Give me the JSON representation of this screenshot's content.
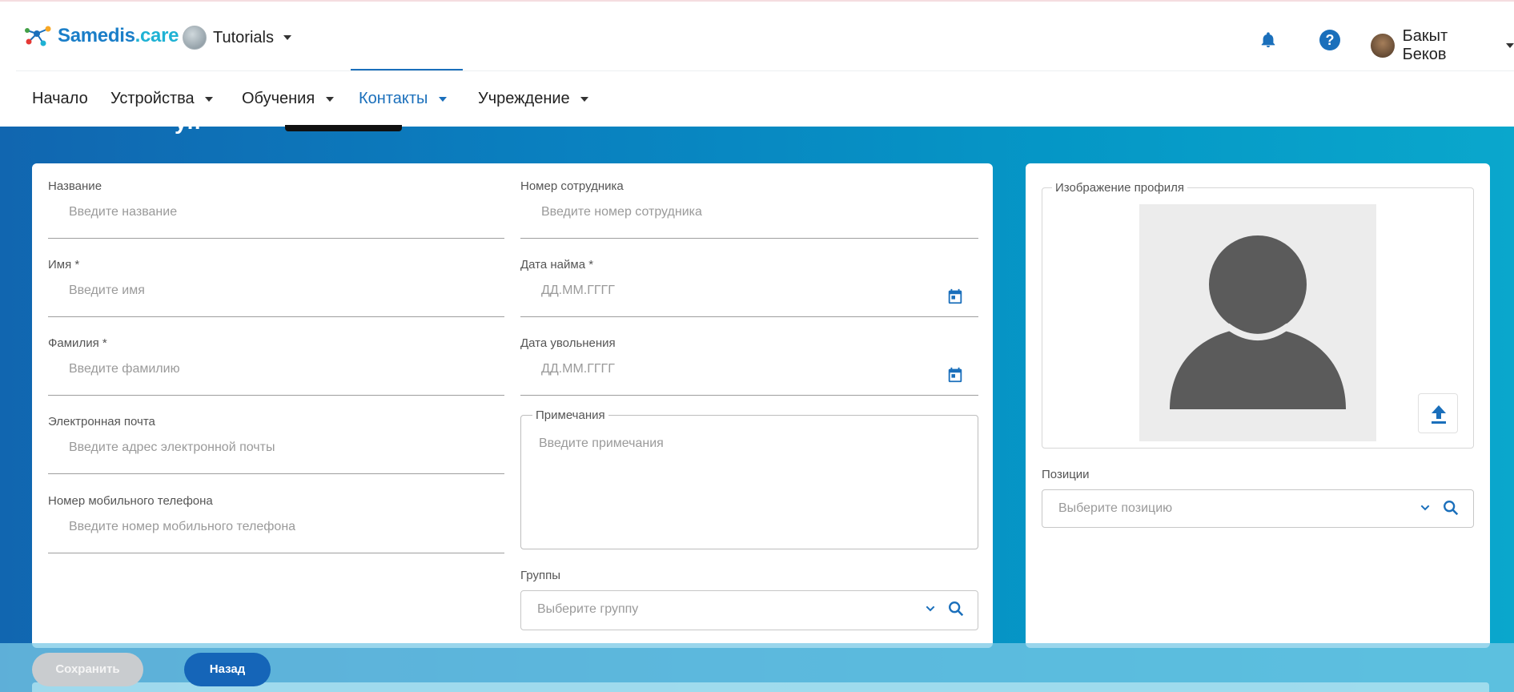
{
  "header": {
    "logo_text_main": "Samedis",
    "logo_text_tld": ".care",
    "tenant_name": "Tutorials",
    "user_name": "Бакыт Беков"
  },
  "nav": {
    "items": [
      {
        "label": "Начало"
      },
      {
        "label": "Устройства"
      },
      {
        "label": "Обучения"
      },
      {
        "label": "Контакты"
      },
      {
        "label": "Учреждение"
      }
    ]
  },
  "page": {
    "partial_title": "уп"
  },
  "form": {
    "name": {
      "label": "Название",
      "placeholder": "Введите название"
    },
    "first_name": {
      "label": "Имя *",
      "placeholder": "Введите имя"
    },
    "last_name": {
      "label": "Фамилия *",
      "placeholder": "Введите фамилию"
    },
    "email": {
      "label": "Электронная почта",
      "placeholder": "Введите адрес электронной почты"
    },
    "mobile": {
      "label": "Номер мобильного телефона",
      "placeholder": "Введите номер мобильного телефона"
    },
    "employee_number": {
      "label": "Номер сотрудника",
      "placeholder": "Введите номер сотрудника"
    },
    "hire_date": {
      "label": "Дата найма *",
      "placeholder": "ДД.ММ.ГГГГ"
    },
    "termination_date": {
      "label": "Дата увольнения",
      "placeholder": "ДД.ММ.ГГГГ"
    },
    "notes": {
      "label": "Примечания",
      "placeholder": "Введите примечания"
    },
    "groups": {
      "label": "Группы",
      "placeholder": "Выберите группу"
    },
    "profile_image": {
      "label": "Изображение профиля"
    },
    "positions": {
      "label": "Позиции",
      "placeholder": "Выберите позицию"
    }
  },
  "actions": {
    "save_label": "Сохранить",
    "back_label": "Назад"
  },
  "colors": {
    "brand_blue": "#1a6fbb",
    "logo_accent": "#1fb2d4",
    "save_disabled": "#c9cccf",
    "back_button": "#1565b8"
  },
  "icons": [
    "bell-icon",
    "help-icon",
    "calendar-icon",
    "chevron-down-icon",
    "search-icon",
    "upload-icon",
    "avatar-placeholder-icon"
  ]
}
